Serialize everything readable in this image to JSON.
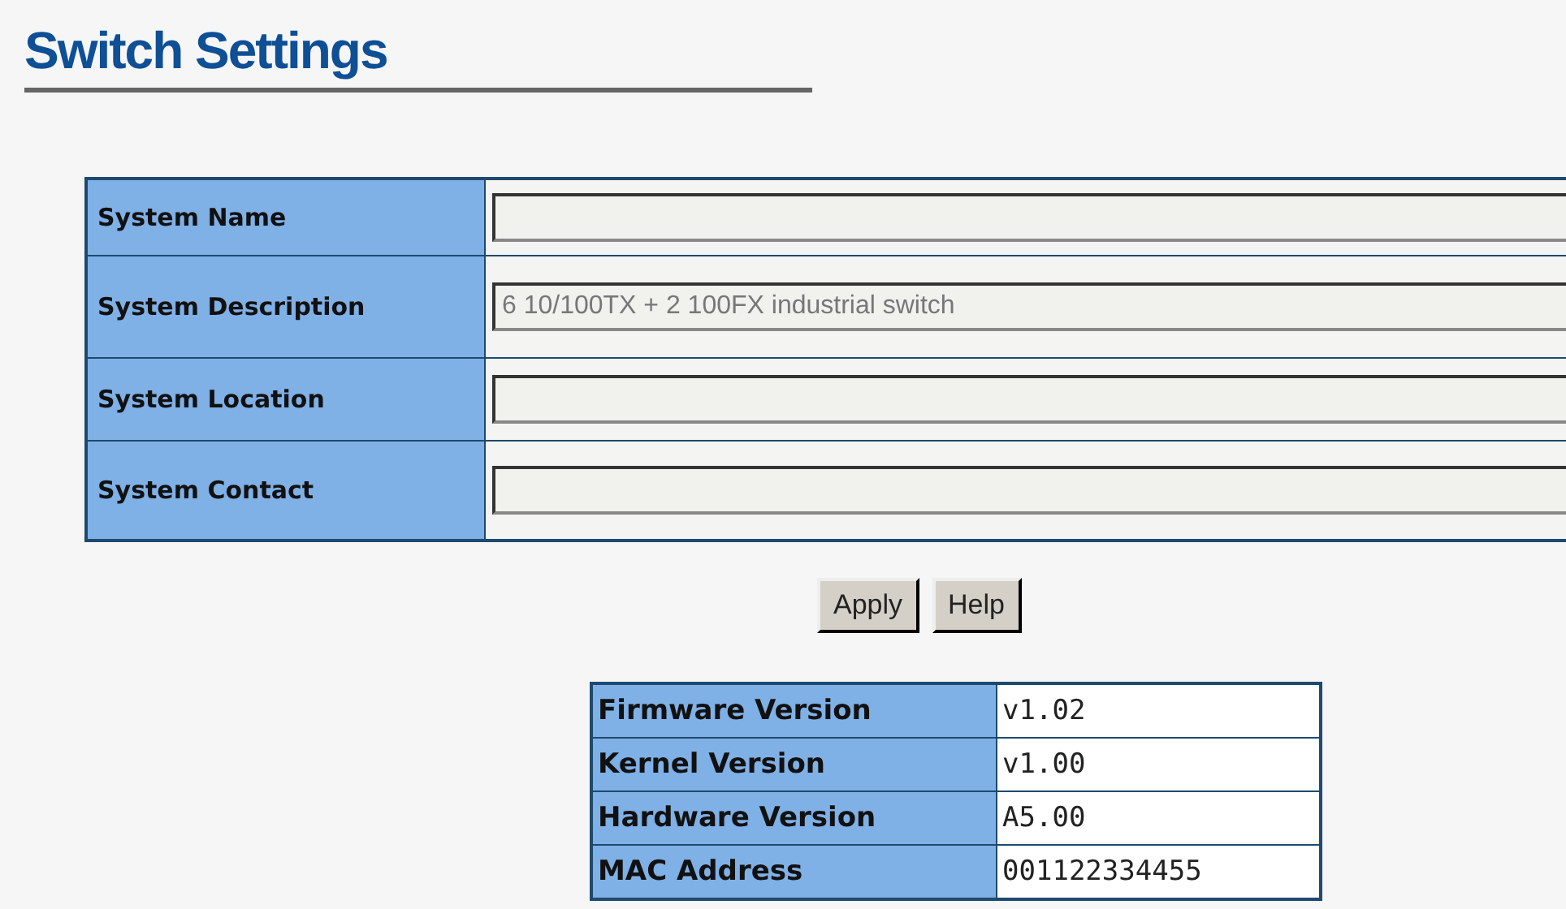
{
  "title": "Switch Settings",
  "settings": [
    {
      "label": "System Name"
    },
    {
      "label": "System Description",
      "value": "6 10/100TX + 2 100FX industrial switch"
    },
    {
      "label": "System Location"
    },
    {
      "label": "System Contact"
    }
  ],
  "buttons": [
    "Apply",
    "Help"
  ],
  "info": [
    {
      "label": "Firmware Version",
      "value": "v1.02"
    },
    {
      "label": "Kernel Version",
      "value": "v1.00"
    },
    {
      "label": "Hardware Version",
      "value": "A5.00"
    },
    {
      "label": "MAC Address",
      "value": "001122334455"
    }
  ]
}
